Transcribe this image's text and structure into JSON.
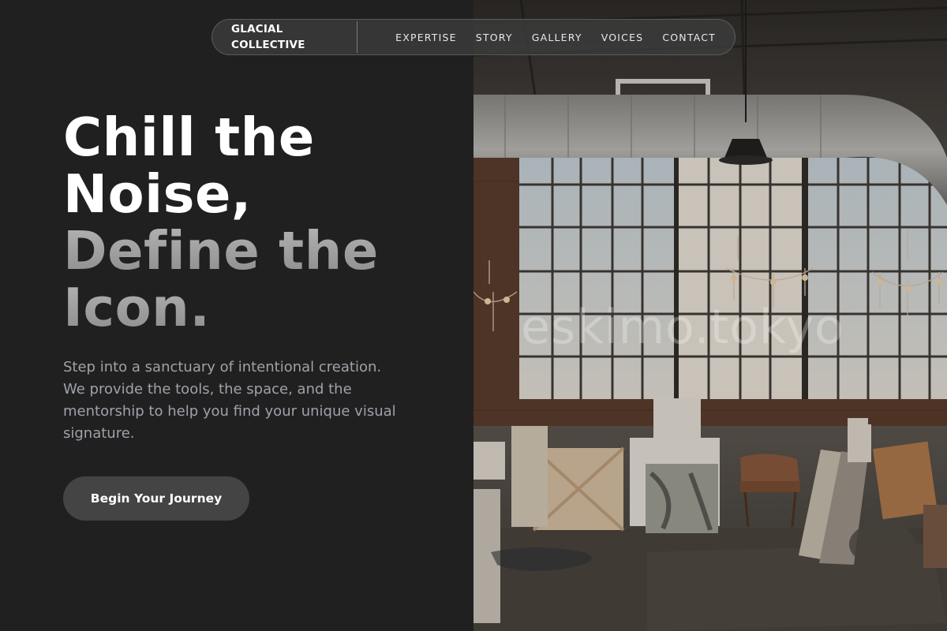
{
  "nav": {
    "brand": "GLACIAL COLLECTIVE",
    "links": [
      {
        "label": "EXPERTISE"
      },
      {
        "label": "STORY"
      },
      {
        "label": "GALLERY"
      },
      {
        "label": "VOICES"
      },
      {
        "label": "CONTACT"
      }
    ]
  },
  "hero": {
    "headline_line1": "Chill the",
    "headline_line2": "Noise,",
    "headline_line3": "Define the",
    "headline_line4": "Icon.",
    "description": "Step into a sanctuary of intentional creation. We provide the tools, the space, and the mentorship to help you find your unique visual signature.",
    "cta_label": "Begin Your Journey"
  },
  "image": {
    "watermark": "eskimo.tokyo",
    "subject": "loft-art-studio-photo"
  },
  "colors": {
    "background": "#202021",
    "navbar": "#3c3c3c",
    "headline_primary": "#ffffff",
    "headline_secondary": "#9a9a9a",
    "body_text": "#9ea2a8",
    "button": "#444445"
  }
}
